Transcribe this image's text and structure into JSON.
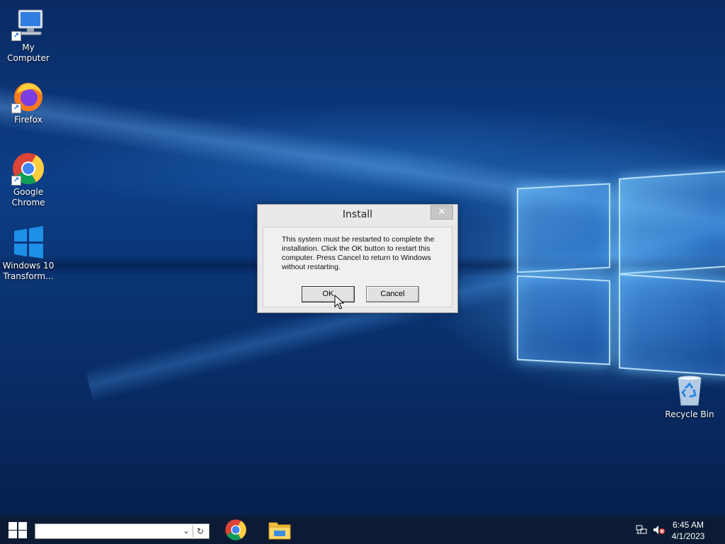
{
  "desktop": {
    "icons": [
      {
        "label": "My Computer",
        "icon": "computer-icon"
      },
      {
        "label": "Firefox",
        "icon": "firefox-icon"
      },
      {
        "label": "Google Chrome",
        "icon": "chrome-icon"
      },
      {
        "label": "Windows 10 Transform...",
        "icon": "windows-logo-icon"
      },
      {
        "label": "Recycle Bin",
        "icon": "recycle-bin-icon"
      }
    ]
  },
  "dialog": {
    "title": "Install",
    "message": "This system must be restarted to complete the installation. Click the OK button to restart this computer. Press Cancel to return to Windows without restarting.",
    "ok_label": "OK",
    "cancel_label": "Cancel",
    "close_glyph": "✕"
  },
  "taskbar": {
    "search_value": "",
    "apps": [
      {
        "icon": "chrome-icon"
      },
      {
        "icon": "file-explorer-icon"
      }
    ],
    "tray": {
      "network_icon": "network-icon",
      "volume_icon": "volume-muted-icon"
    },
    "clock": {
      "time": "6:45 AM",
      "date": "4/1/2023"
    }
  },
  "colors": {
    "taskbar": "#0c1b33",
    "dialog_bg": "#e9e9e9",
    "accent": "#0078d7"
  }
}
